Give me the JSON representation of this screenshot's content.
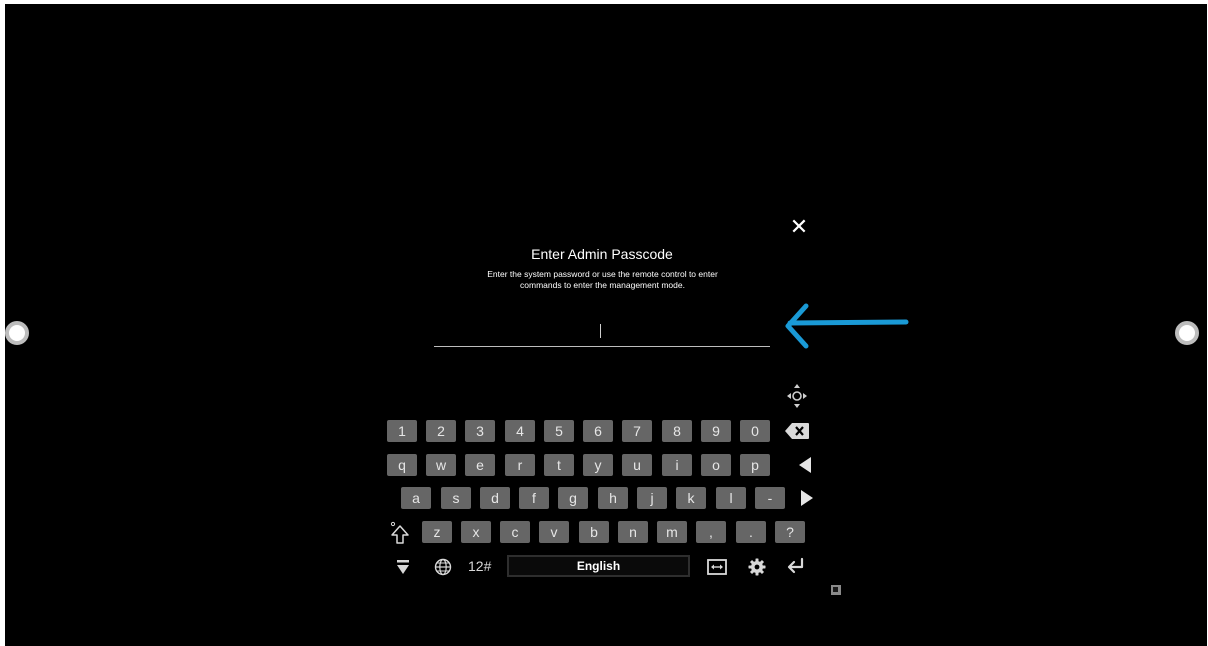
{
  "dialog": {
    "title": "Enter Admin Passcode",
    "description_line1": "Enter the system password or use the remote control to enter",
    "description_line2": "commands to enter the management mode.",
    "close_glyph": "✕",
    "input_value": ""
  },
  "keyboard": {
    "row_numbers": [
      "1",
      "2",
      "3",
      "4",
      "5",
      "6",
      "7",
      "8",
      "9",
      "0"
    ],
    "row_qwerty": [
      "q",
      "w",
      "e",
      "r",
      "t",
      "y",
      "u",
      "i",
      "o",
      "p"
    ],
    "row_home": [
      "a",
      "s",
      "d",
      "f",
      "g",
      "h",
      "j",
      "k",
      "l",
      "-"
    ],
    "row_bottom": [
      "z",
      "x",
      "c",
      "v",
      "b",
      "n",
      "m",
      ",",
      ".",
      "?"
    ],
    "mode_label": "12#",
    "space_label": "English",
    "icons": {
      "backspace": "backspace-icon",
      "left": "arrow-left-icon",
      "right": "arrow-right-icon",
      "shift": "shift-icon",
      "hide": "hide-keyboard-icon",
      "globe": "globe-icon",
      "cursor_move": "cursor-move-icon",
      "settings": "gear-icon",
      "enter": "enter-icon",
      "resize": "resize-icon",
      "move": "move-icon"
    }
  },
  "annotation": {
    "arrow_color": "#1a9ad6"
  },
  "colors": {
    "background": "#000000",
    "key": "#666666",
    "text": "#ffffff"
  }
}
